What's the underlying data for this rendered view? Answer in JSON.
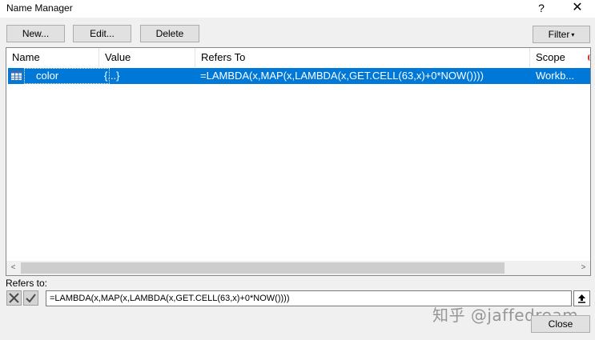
{
  "window": {
    "title": "Name Manager",
    "help_label": "?",
    "close_label": "✕"
  },
  "toolbar": {
    "new_label": "New...",
    "edit_label": "Edit...",
    "delete_label": "Delete",
    "filter_label": "Filter",
    "filter_arrow": "▾"
  },
  "columns": [
    "Name",
    "Value",
    "Refers To",
    "Scope"
  ],
  "rows": [
    {
      "name": "color",
      "value": "{...}",
      "refers_to": "=LAMBDA(x,MAP(x,LAMBDA(x,GET.CELL(63,x)+0*NOW())))",
      "scope": "Workb...",
      "icon": "table-name-icon",
      "selected": true
    }
  ],
  "scrollbar": {
    "left_arrow": "<",
    "right_arrow": ">"
  },
  "refers_to": {
    "label": "Refers to:",
    "value": "=LAMBDA(x,MAP(x,LAMBDA(x,GET.CELL(63,x)+0*NOW())))"
  },
  "footer": {
    "close_label": "Close"
  },
  "watermark": "知乎 @jaffedream",
  "colors": {
    "selection": "#0078d7",
    "dialog_bg": "#f0f0f0",
    "button_bg": "#e1e1e1"
  }
}
